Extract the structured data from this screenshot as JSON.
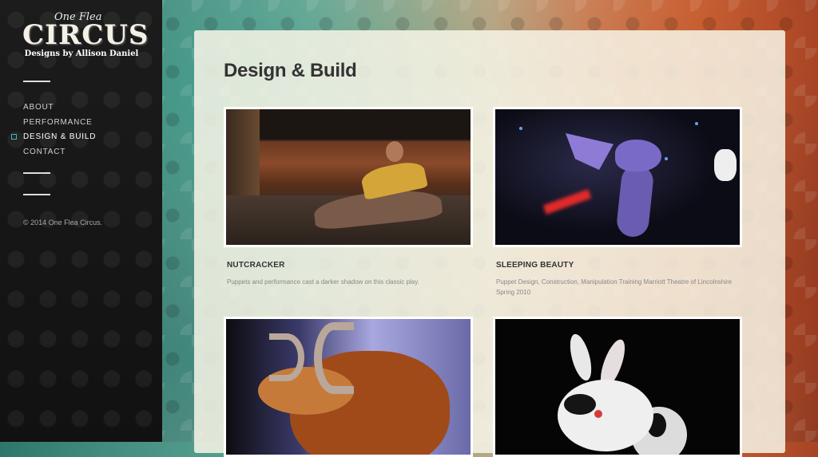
{
  "brand": {
    "logo_small": "One Flea",
    "logo_main": "CIRCUS",
    "logo_sub": "Designs by Allison Daniel"
  },
  "nav": {
    "items": [
      {
        "label": "ABOUT",
        "active": false
      },
      {
        "label": "PERFORMANCE",
        "active": false
      },
      {
        "label": "DESIGN & BUILD",
        "active": true
      },
      {
        "label": "CONTACT",
        "active": false
      }
    ],
    "accent_color": "#3fb8c0"
  },
  "footer": {
    "copyright": "© 2014 One Flea Circus."
  },
  "main": {
    "title": "Design & Build",
    "cards": [
      {
        "title": "NUTCRACKER",
        "description": "Puppets and performance cast a darker shadow on this classic play.",
        "image_icon": "nutcracker-doll-photo"
      },
      {
        "title": "SLEEPING BEAUTY",
        "description": "Puppet Design, Construction, Manipulation Training Marriott Theatre of Lincolnshire Spring 2010",
        "image_icon": "dragon-puppet-photo"
      },
      {
        "title": "",
        "description": "",
        "image_icon": "ram-puppet-photo"
      },
      {
        "title": "",
        "description": "",
        "image_icon": "rabbit-puppet-photo"
      }
    ]
  }
}
